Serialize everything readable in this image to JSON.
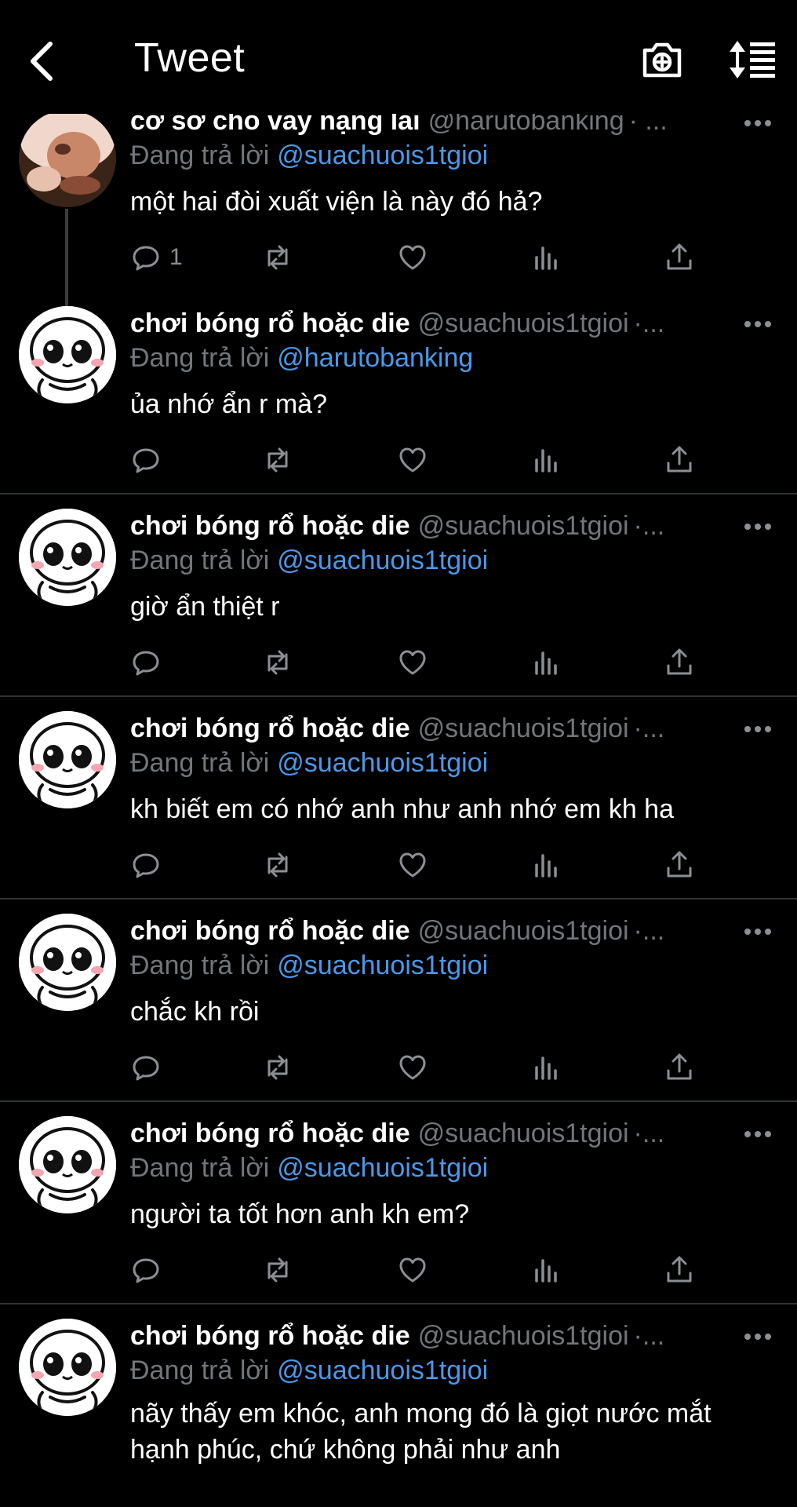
{
  "header": {
    "title": "Tweet",
    "icons": [
      "back-chevron-icon",
      "camera-plus-icon",
      "sort-icon"
    ]
  },
  "colors": {
    "background": "#000000",
    "text": "#ffffff",
    "secondary": "#71767b",
    "link": "#4a99e9",
    "divider": "#2f3336"
  },
  "icons": {
    "actions": [
      "reply-icon",
      "retweet-icon",
      "like-icon",
      "analytics-icon",
      "share-icon"
    ],
    "more": "more-dots-icon"
  },
  "tweets": [
    {
      "name": "cơ sở cho vay nặng lãi",
      "handle": "@harutobanking",
      "dot": "· ...",
      "reply_prefix": "Đang trả lời",
      "reply_to": "@suachuois1tgioi",
      "text": "một hai đòi xuất viện là này đó hả?",
      "reply_count": "1"
    },
    {
      "name": "chơi bóng rổ hoặc die",
      "handle": "@suachuois1tgioi",
      "dot": "·...",
      "reply_prefix": "Đang trả lời",
      "reply_to": "@harutobanking",
      "text": "ủa nhớ ẩn r mà?"
    },
    {
      "name": "chơi bóng rổ hoặc die",
      "handle": "@suachuois1tgioi",
      "dot": "·...",
      "reply_prefix": "Đang trả lời",
      "reply_to": "@suachuois1tgioi",
      "text": "giờ ẩn thiệt r"
    },
    {
      "name": "chơi bóng rổ hoặc die",
      "handle": "@suachuois1tgioi",
      "dot": "·...",
      "reply_prefix": "Đang trả lời",
      "reply_to": "@suachuois1tgioi",
      "text": "kh biết em có nhớ anh như anh nhớ em kh ha"
    },
    {
      "name": "chơi bóng rổ hoặc die",
      "handle": "@suachuois1tgioi",
      "dot": "·...",
      "reply_prefix": "Đang trả lời",
      "reply_to": "@suachuois1tgioi",
      "text": "chắc kh rồi"
    },
    {
      "name": "chơi bóng rổ hoặc die",
      "handle": "@suachuois1tgioi",
      "dot": "·...",
      "reply_prefix": "Đang trả lời",
      "reply_to": "@suachuois1tgioi",
      "text": "người ta tốt hơn anh kh em?"
    },
    {
      "name": "chơi bóng rổ hoặc die",
      "handle": "@suachuois1tgioi",
      "dot": "·...",
      "reply_prefix": "Đang trả lời",
      "reply_to": "@suachuois1tgioi",
      "text": "nãy thấy em khóc, anh mong đó là giọt nước mắt hạnh phúc, chứ không phải như anh"
    }
  ]
}
